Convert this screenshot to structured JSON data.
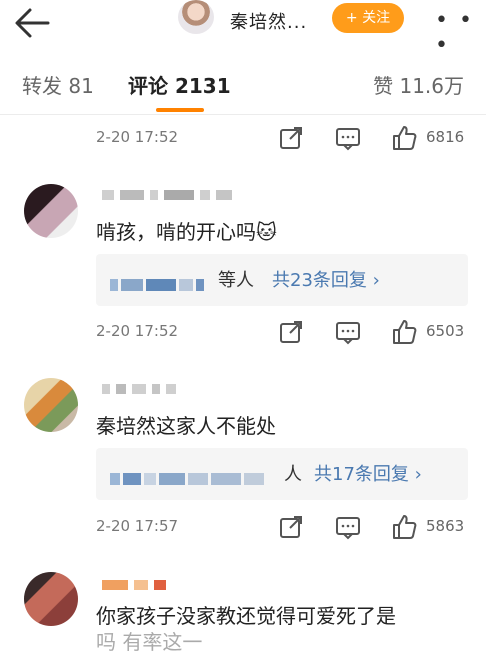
{
  "header": {
    "title": "秦培然...",
    "follow_label": "+ 关注",
    "more_label": "• • •",
    "icons": [
      "back-arrow-icon",
      "more-icon"
    ],
    "accent": "#ff9c1a"
  },
  "tabs": {
    "repost": "转发 81",
    "comments": "评论 2131",
    "likes": "赞 11.6万",
    "active": "comments",
    "underline_color": "#ff8200"
  },
  "comments": [
    {
      "time": "2-20 17:52",
      "likes": "6816"
    },
    {
      "text": "啃孩，啃的开心吗",
      "emoji": "🐱",
      "reply_suffix": "等人",
      "reply_count": "共23条回复 ›",
      "time": "2-20 17:52",
      "likes": "6503"
    },
    {
      "text": "秦培然这家人不能处",
      "reply_suffix": "人",
      "reply_count": "共17条回复 ›",
      "time": "2-20 17:57",
      "likes": "5863"
    },
    {
      "text": "你家孩子没家教还觉得可爱死了是",
      "text_faded": "吗 有率这一"
    }
  ],
  "link_color": "#4a79b0"
}
